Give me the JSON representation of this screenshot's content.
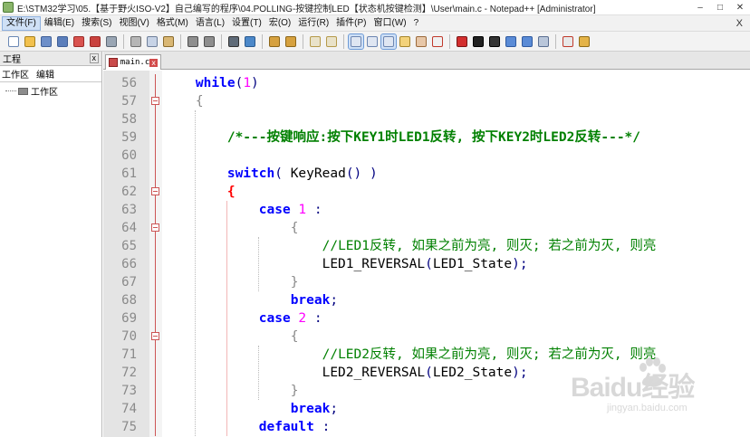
{
  "window": {
    "title": "E:\\STM32学习\\05.【基于野火ISO-V2】自己编写的程序\\04.POLLING-按键控制LED【状态机按键检测】\\User\\main.c - Notepad++ [Administrator]",
    "controls": [
      "–",
      "□",
      "✕"
    ]
  },
  "menu": {
    "items": [
      "文件(F)",
      "编辑(E)",
      "搜索(S)",
      "视图(V)",
      "格式(M)",
      "语言(L)",
      "设置(T)",
      "宏(O)",
      "运行(R)",
      "插件(P)",
      "窗口(W)",
      "?"
    ],
    "close": "X"
  },
  "toolbar": {
    "icons": [
      {
        "name": "new-file-icon",
        "color": "#ffffff",
        "border": "#6a88b5"
      },
      {
        "name": "open-file-icon",
        "color": "#f2c14e",
        "border": "#a5801f"
      },
      {
        "name": "save-icon",
        "color": "#6d8fc9",
        "border": "#3f5f97"
      },
      {
        "name": "save-all-icon",
        "color": "#5b7ebb",
        "border": "#3f5f97"
      },
      {
        "name": "close-file-icon",
        "color": "#d9534f",
        "border": "#9b2b27"
      },
      {
        "name": "close-all-icon",
        "color": "#c9423e",
        "border": "#9b2b27"
      },
      {
        "name": "print-icon",
        "color": "#9aa6b4",
        "border": "#5d6874"
      },
      {
        "sep": true
      },
      {
        "name": "cut-icon",
        "color": "#b6b6b6",
        "border": "#6f6f6f"
      },
      {
        "name": "copy-icon",
        "color": "#c7d3e6",
        "border": "#6f7f99"
      },
      {
        "name": "paste-icon",
        "color": "#d9b774",
        "border": "#8a6b2c"
      },
      {
        "sep": true
      },
      {
        "name": "undo-icon",
        "color": "#8e8e8e",
        "border": "#4f4f4f"
      },
      {
        "name": "redo-icon",
        "color": "#8e8e8e",
        "border": "#4f4f4f"
      },
      {
        "sep": true
      },
      {
        "name": "find-icon",
        "color": "#5f6b78",
        "border": "#333"
      },
      {
        "name": "replace-icon",
        "color": "#4c88c9",
        "border": "#2b5a8f"
      },
      {
        "sep": true
      },
      {
        "name": "zoom-in-icon",
        "color": "#d6a13f",
        "border": "#8c6619"
      },
      {
        "name": "zoom-out-icon",
        "color": "#d6a13f",
        "border": "#8c6619"
      },
      {
        "sep": true
      },
      {
        "name": "sync-vertical-icon",
        "color": "#e9e2c9",
        "border": "#b59a4b"
      },
      {
        "name": "sync-horizontal-icon",
        "color": "#e9e2c9",
        "border": "#b59a4b"
      },
      {
        "sep": true
      },
      {
        "name": "word-wrap-icon",
        "color": "#dfe6f2",
        "border": "#6d86b1",
        "pressed": true
      },
      {
        "name": "show-all-chars-icon",
        "color": "#dfe6f2",
        "border": "#6d86b1"
      },
      {
        "name": "indent-guide-icon",
        "color": "#dfe6f2",
        "border": "#6d86b1",
        "pressed": true
      },
      {
        "name": "user-lang-icon",
        "color": "#f3d27a",
        "border": "#a6862c"
      },
      {
        "name": "doc-map-icon",
        "color": "#e7c7a8",
        "border": "#9b6a3c"
      },
      {
        "name": "function-list-icon",
        "color": "#f0f0f0",
        "border": "#c0392b"
      },
      {
        "sep": true
      },
      {
        "name": "record-macro-icon",
        "color": "#d32f2f",
        "border": "#7a1515"
      },
      {
        "name": "stop-record-icon",
        "color": "#222222",
        "border": "#000000"
      },
      {
        "name": "play-macro-icon",
        "color": "#333333",
        "border": "#000000"
      },
      {
        "name": "play-multiple-icon",
        "color": "#5a8bd6",
        "border": "#2f5aa0"
      },
      {
        "name": "save-macro-icon",
        "color": "#5a8bd6",
        "border": "#2f5aa0"
      },
      {
        "name": "macro-list-icon",
        "color": "#b9c6da",
        "border": "#5b6f91"
      },
      {
        "sep": true
      },
      {
        "name": "spell-check-icon",
        "color": "#e8e8e8",
        "border": "#c0392b"
      },
      {
        "name": "plugin-icon",
        "color": "#e4b347",
        "border": "#8f6b16"
      }
    ]
  },
  "sidepanel": {
    "title": "工程",
    "close": "x",
    "tabs": [
      "工作区",
      "编辑"
    ],
    "tree_root": "工作区"
  },
  "editor": {
    "tab_label": "main.c",
    "tab_close": "x",
    "lines": [
      {
        "n": "56",
        "fold": "line",
        "html": "    <span class=\"kw\">while</span><span class=\"punct\">(</span><span class=\"num\">1</span><span class=\"punct\">)</span>"
      },
      {
        "n": "57",
        "fold": "box",
        "html": "    <span class=\"brace\">{</span>"
      },
      {
        "n": "58",
        "fold": "line",
        "html": ""
      },
      {
        "n": "59",
        "fold": "line",
        "html": "        <span class=\"cmb\">/*---按键响应:按下KEY1时LED1反转, 按下KEY2时LED2反转---*/</span>"
      },
      {
        "n": "60",
        "fold": "line",
        "html": ""
      },
      {
        "n": "61",
        "fold": "line",
        "html": "        <span class=\"kw\">switch</span><span class=\"punct\">(</span> KeyRead<span class=\"punct\">()</span> <span class=\"punct\">)</span>"
      },
      {
        "n": "62",
        "fold": "box",
        "html": "        <span class=\"brace-hl\">{</span>"
      },
      {
        "n": "63",
        "fold": "line",
        "html": "            <span class=\"kw\">case</span> <span class=\"num\">1</span> <span class=\"punct\">:</span>"
      },
      {
        "n": "64",
        "fold": "box",
        "html": "                <span class=\"brace\">{</span>"
      },
      {
        "n": "65",
        "fold": "line",
        "html": "                    <span class=\"cm\">//LED1反转, 如果之前为亮, 则灭; 若之前为灭, 则亮</span>"
      },
      {
        "n": "66",
        "fold": "line",
        "html": "                    LED1_REVERSAL<span class=\"punct\">(</span>LED1_State<span class=\"punct\">);</span>"
      },
      {
        "n": "67",
        "fold": "end",
        "html": "                <span class=\"brace\">}</span>"
      },
      {
        "n": "68",
        "fold": "line",
        "html": "                <span class=\"kw\">break</span><span class=\"punct\">;</span>"
      },
      {
        "n": "69",
        "fold": "line",
        "html": "            <span class=\"kw\">case</span> <span class=\"num\">2</span> <span class=\"punct\">:</span>"
      },
      {
        "n": "70",
        "fold": "box",
        "html": "                <span class=\"brace\">{</span>"
      },
      {
        "n": "71",
        "fold": "line",
        "html": "                    <span class=\"cm\">//LED2反转, 如果之前为亮, 则灭; 若之前为灭, 则亮</span>"
      },
      {
        "n": "72",
        "fold": "line",
        "html": "                    LED2_REVERSAL<span class=\"punct\">(</span>LED2_State<span class=\"punct\">);</span>"
      },
      {
        "n": "73",
        "fold": "end",
        "html": "                <span class=\"brace\">}</span>"
      },
      {
        "n": "74",
        "fold": "line",
        "html": "                <span class=\"kw\">break</span><span class=\"punct\">;</span>"
      },
      {
        "n": "75",
        "fold": "line",
        "html": "            <span class=\"kw\">default</span> <span class=\"punct\">:</span>"
      }
    ]
  },
  "watermark": {
    "logo": "Baidu经验",
    "sub": "jingyan.baidu.com"
  }
}
